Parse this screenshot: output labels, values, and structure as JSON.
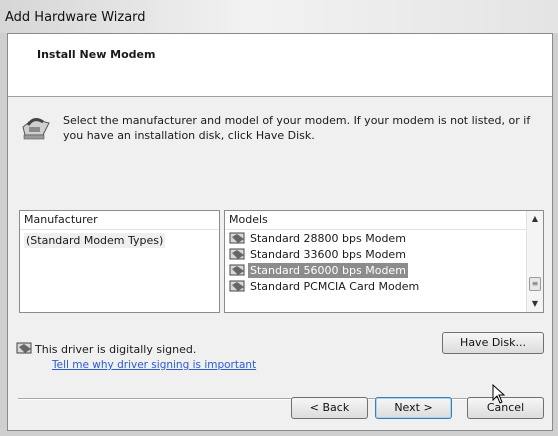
{
  "window": {
    "title": "Add Hardware Wizard"
  },
  "header": {
    "title": "Install New Modem"
  },
  "instructions": "Select the manufacturer and model of your modem. If your modem is not listed, or if you have an installation disk, click Have Disk.",
  "manufacturer_list": {
    "header": "Manufacturer",
    "items": [
      "(Standard Modem Types)"
    ],
    "selected": "(Standard Modem Types)"
  },
  "models_list": {
    "header": "Models",
    "items": [
      "Standard 28800 bps Modem",
      "Standard 33600 bps Modem",
      "Standard 56000 bps Modem",
      "Standard PCMCIA Card Modem"
    ],
    "selected": "Standard 56000 bps Modem"
  },
  "driver": {
    "signed_text": "This driver is digitally signed.",
    "link_text": "Tell me why driver signing is important"
  },
  "buttons": {
    "have_disk": "Have Disk...",
    "back": "< Back",
    "next": "Next >",
    "cancel": "Cancel"
  },
  "icons": [
    "modem-icon",
    "driver-icon",
    "signed-driver-icon",
    "mouse-cursor-icon"
  ]
}
